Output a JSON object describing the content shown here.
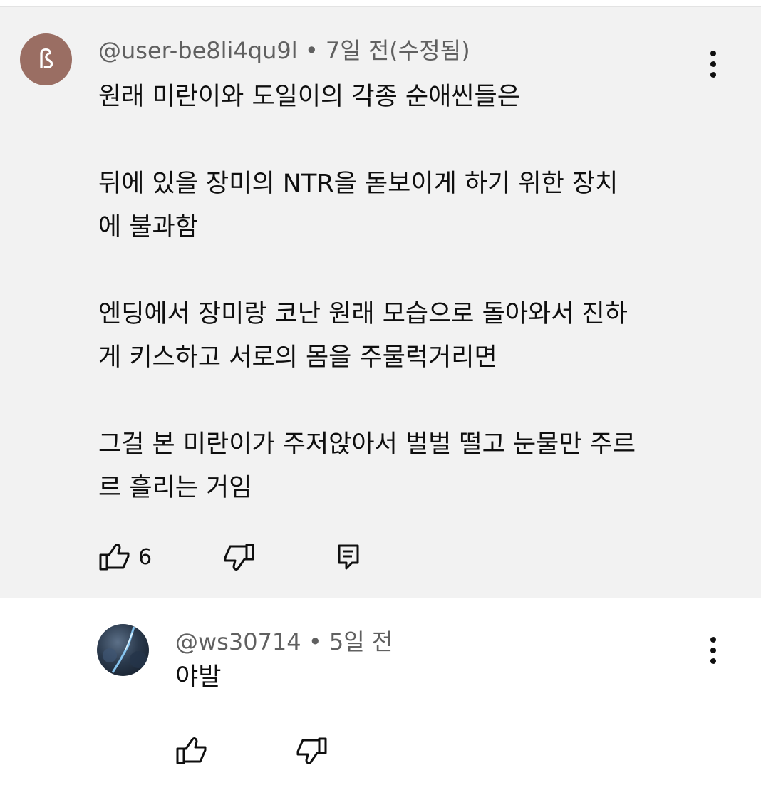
{
  "comment": {
    "avatar_letter": "ß",
    "avatar_color": "#9a6e63",
    "author": "@user-be8li4qu9l",
    "separator": "•",
    "time": "7일 전(수정됨)",
    "lines": [
      "원래 미란이와 도일이의 각종 순애씬들은",
      "",
      "뒤에 있을 장미의 NTR을 돋보이게 하기 위한 장치",
      "에 불과함",
      "",
      "엔딩에서 장미랑 코난 원래 모습으로 돌아와서 진하",
      "게 키스하고 서로의 몸을 주물럭거리면",
      "",
      "그걸 본 미란이가 주저앉아서 벌벌 떨고 눈물만 주르",
      "르 흘리는 거임"
    ],
    "like_count": "6"
  },
  "reply": {
    "author": "@ws30714",
    "separator": "•",
    "time": "5일 전",
    "text": "야발"
  },
  "icons": [
    "more-vert-icon",
    "thumb-up-icon",
    "thumb-down-icon",
    "reply-icon"
  ]
}
